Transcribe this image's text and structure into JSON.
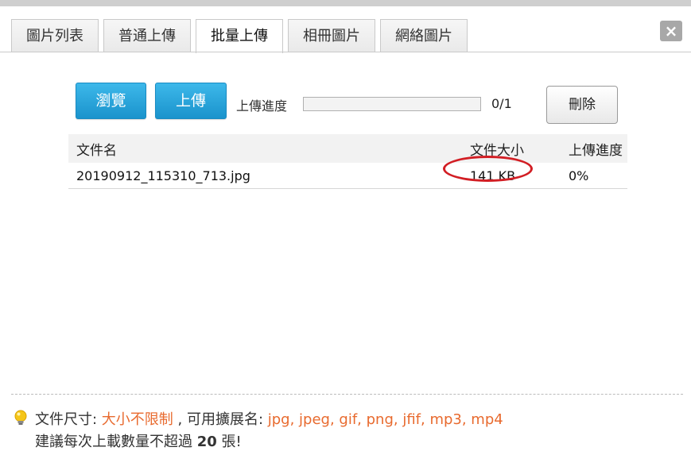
{
  "tabs": [
    {
      "label": "圖片列表",
      "active": false
    },
    {
      "label": "普通上傳",
      "active": false
    },
    {
      "label": "批量上傳",
      "active": true
    },
    {
      "label": "相冊圖片",
      "active": false
    },
    {
      "label": "網絡圖片",
      "active": false
    }
  ],
  "close_icon": "close-icon",
  "toolbar": {
    "browse_label": "瀏覽",
    "upload_label": "上傳",
    "progress_label": "上傳進度",
    "progress_count": "0/1",
    "progress_fraction": 0,
    "delete_label": "刪除"
  },
  "table": {
    "headers": {
      "name": "文件名",
      "size": "文件大小",
      "progress": "上傳進度"
    },
    "rows": [
      {
        "name": "20190912_115310_713.jpg",
        "size": "141 KB",
        "progress": "0%"
      }
    ]
  },
  "footer": {
    "size_label": "文件尺寸: ",
    "size_value": "大小不限制",
    "ext_label": " , 可用擴展名: ",
    "ext_value": "jpg, jpeg, gif, png, jfif, mp3, mp4",
    "suggest_prefix": "建議每次上載數量不超過 ",
    "suggest_count": "20",
    "suggest_suffix": " 張!"
  },
  "colors": {
    "accent_blue": "#1a93cc",
    "highlight_red": "#d21e24",
    "orange_text": "#e86a2e"
  }
}
